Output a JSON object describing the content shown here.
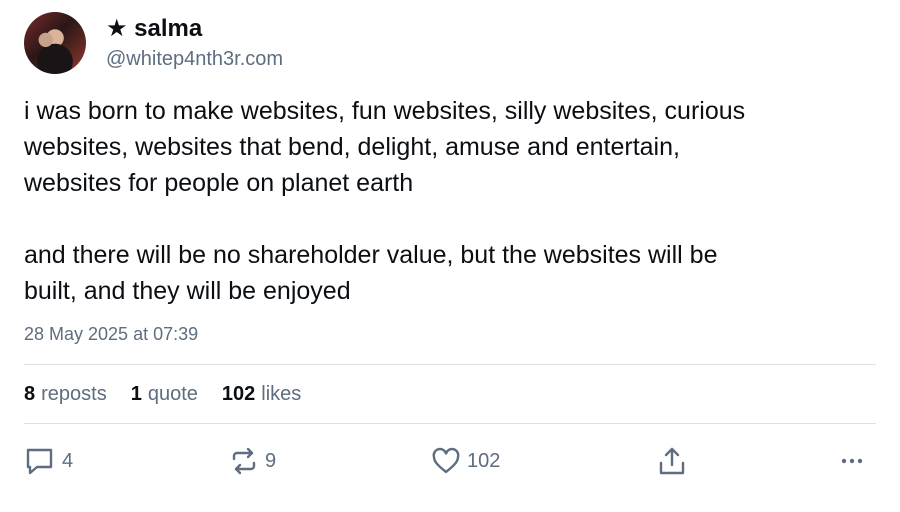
{
  "author": {
    "display_name": "★ salma",
    "handle": "@whitep4nth3r.com"
  },
  "post": {
    "paragraphs": [
      "i was born to make websites, fun websites, silly websites, curious\nwebsites, websites that bend, delight, amuse and entertain,\nwebsites for people on planet earth",
      "and there will be no shareholder value, but the websites will be\nbuilt, and they will be enjoyed"
    ],
    "timestamp": "28 May 2025 at 07:39"
  },
  "stats": {
    "reposts_count": "8",
    "reposts_label": "reposts",
    "quotes_count": "1",
    "quotes_label": "quote",
    "likes_count": "102",
    "likes_label": "likes"
  },
  "actions": {
    "reply_icon": "reply-icon",
    "reply_count": "4",
    "repost_icon": "repost-icon",
    "repost_count": "9",
    "like_icon": "heart-icon",
    "like_count": "102",
    "share_icon": "share-icon",
    "more_icon": "more-icon"
  },
  "colors": {
    "text": "#0b0f14",
    "muted": "#5e6d7f",
    "divider": "#dbe1e7"
  }
}
